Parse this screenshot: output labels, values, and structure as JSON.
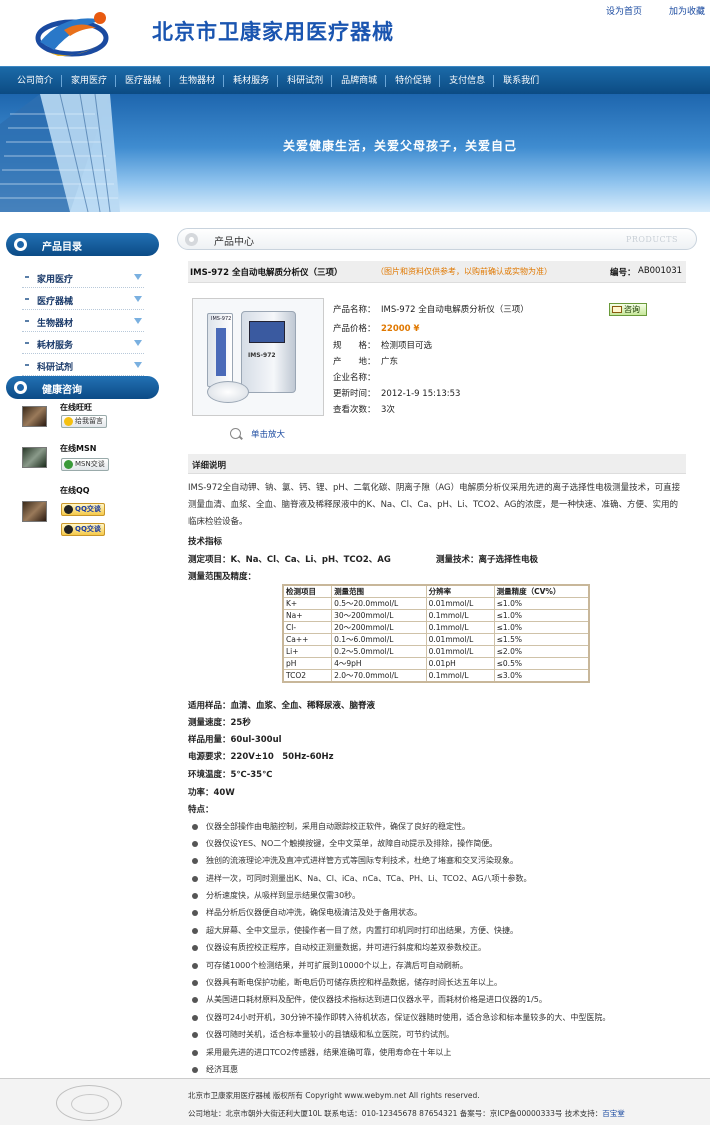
{
  "header": {
    "title": "北京市卫康家用医疗器械",
    "links": [
      "设为首页",
      "加为收藏"
    ]
  },
  "nav": [
    "公司简介",
    "家用医疗",
    "医疗器械",
    "生物器材",
    "耗材服务",
    "科研试剂",
    "品牌商城",
    "特价促销",
    "支付信息",
    "联系我们"
  ],
  "banner": {
    "slogan": "关爱健康生活，关爱父母孩子，关爱自己"
  },
  "sidebar": {
    "products_title": "产品目录",
    "categories": [
      "家用医疗",
      "医疗器械",
      "生物器材",
      "耗材服务",
      "科研试剂"
    ],
    "consult_title": "健康咨询",
    "consult": [
      {
        "name": "在线旺旺",
        "button": "给我留言"
      },
      {
        "name": "在线MSN",
        "button": "MSN交谈"
      },
      {
        "name": "在线QQ",
        "buttons": [
          "QQ交谈",
          "QQ交谈"
        ]
      }
    ]
  },
  "panel": {
    "title": "产品中心",
    "en": "PRODUCTS"
  },
  "product": {
    "name": "IMS-972 全自动电解质分析仪（三项）",
    "note": "（图片和资料仅供参考，以购前确认或实物为准）",
    "code_label": "编号：",
    "code": "AB001031",
    "specs": [
      {
        "k": "产品名称：",
        "v": "IMS-972 全自动电解质分析仪（三项）"
      },
      {
        "k": "产品价格：",
        "v": "22000 ¥"
      },
      {
        "k": "规　　格：",
        "v": "检测项目可选"
      },
      {
        "k": "产　　地：",
        "v": "广东"
      },
      {
        "k": "企业名称：",
        "v": ""
      },
      {
        "k": "更新时间：",
        "v": "2012-1-9 15:13:53"
      },
      {
        "k": "查看次数：",
        "v": "3次"
      }
    ],
    "consult_btn": "咨询",
    "zoom": "单击放大",
    "device_model": "IMS-972"
  },
  "detail": {
    "title": "详细说明",
    "intro": "IMS-972全自动钾、钠、氯、钙、锂、pH、二氧化碳、阴离子隙（AG）电解质分析仪采用先进的离子选择性电极测量技术，可直接测量血清、血浆、全血、脑脊液及稀释尿液中的K、Na、Cl、Ca、pH、Li、TCO2、AG的浓度，是一种快速、准确、方便、实用的临床检验设备。",
    "tech_title": "技术指标",
    "measure_items": "测定项目：K、Na、Cl、Ca、Li、pH、TCO2、AG",
    "measure_tech": "测量技术：离子选择性电极",
    "range_title": "测量范围及精度：",
    "table": {
      "headers": [
        "检测项目",
        "测量范围",
        "分辨率",
        "测量精度（CV%）"
      ],
      "rows": [
        [
          "K+",
          "0.5～20.0mmol/L",
          "0.01mmol/L",
          "≤1.0%"
        ],
        [
          "Na+",
          "30～200mmol/L",
          "0.1mmol/L",
          "≤1.0%"
        ],
        [
          "Cl-",
          "20～200mmol/L",
          "0.1mmol/L",
          "≤1.0%"
        ],
        [
          "Ca++",
          "0.1～6.0mmol/L",
          "0.01mmol/L",
          "≤1.5%"
        ],
        [
          "Li+",
          "0.2～5.0mmol/L",
          "0.01mmol/L",
          "≤2.0%"
        ],
        [
          "pH",
          "4～9pH",
          "0.01pH",
          "≤0.5%"
        ],
        [
          "TCO2",
          "2.0～70.0mmol/L",
          "0.1mmol/L",
          "≤3.0%"
        ]
      ]
    },
    "params": [
      "适用样品：血清、血浆、全血、稀释尿液、脑脊液",
      "测量速度：25秒",
      "样品用量：60ul-300ul",
      "电源要求：220V±10　50Hz-60Hz",
      "环境温度：5℃-35℃",
      "功率：40W",
      "特点："
    ],
    "features": [
      "仪器全部操作由电脑控制，采用自动跟踪校正软件，确保了良好的稳定性。",
      "仪器仅设YES、NO二个触摸按键，全中文菜单，故障自动提示及排除，操作简便。",
      "独创的流液理论冲洗及直冲式进样管方式等国际专利技术，杜绝了堵塞和交叉污染现象。",
      "进样一次，可同时测量出K、Na、Cl、iCa、nCa、TCa、PH、Li、TCO2、AG八项十参数。",
      "分析速度快，从吸样到显示结果仅需30秒。",
      "样品分析后仪器便自动冲洗，确保电极清洁及处于备用状态。",
      "超大屏幕、全中文显示，使操作者一目了然，内置打印机同时打印出结果，方便、快捷。",
      "仪器设有质控校正程序，自动校正测量数据，并可进行斜度和均差双参数校正。",
      "可存储1000个检测结果，并可扩展到10000个以上，存满后可自动刷新。",
      "仪器具有断电保护功能，断电后仍可储存质控和样品数据，储存时间长达五年以上。",
      "从美国进口耗材原料及配件，使仪器技术指标达到进口仪器水平，而耗材价格是进口仪器的1/5。",
      "仪器可24小时开机，30分钟不操作即转入待机状态，保证仪器随时使用，适合急诊和标本量较多的大、中型医院。",
      "仪器可随时关机，适合标本量较小的县镇级和私立医院，可节约试剂。",
      "采用最先进的进口TCO2传感器，结果准确可靠，使用寿命在十年以上",
      "经济耳惠"
    ]
  },
  "footer": {
    "line1": "北京市卫康家用医疗器械 版权所有 Copyright www.webym.net All rights reserved.",
    "line2": "公司地址：北京市朝外大街还利大厦10L 联系电话：010-12345678 87654321 备案号：京ICP备00000333号 技术支持：",
    "support": "百宝堂"
  }
}
